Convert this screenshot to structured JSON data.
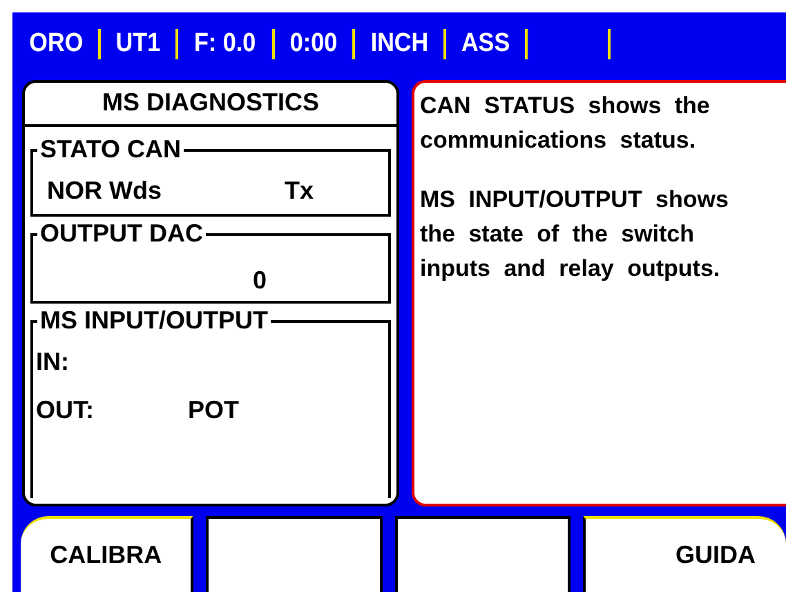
{
  "status_bar": [
    {
      "text": "ORO"
    },
    {
      "text": "UT1"
    },
    {
      "text": "F: 0.0"
    },
    {
      "text": "0:00"
    },
    {
      "text": "INCH"
    },
    {
      "text": "ASS"
    }
  ],
  "diagnostics": {
    "title": "MS DIAGNOSTICS",
    "groups": [
      {
        "title": "STATO CAN",
        "kind": "pair",
        "values": [
          "NOR Wds",
          "Tx"
        ]
      },
      {
        "title": "OUTPUT DAC",
        "kind": "value",
        "values": [
          "0"
        ]
      },
      {
        "title": "MS INPUT/OUTPUT",
        "kind": "io",
        "rows": [
          {
            "label": "IN:"
          },
          {
            "label": "OUT:",
            "value": "POT"
          }
        ]
      }
    ]
  },
  "help": {
    "paragraphs": [
      "CAN STATUS shows the communications status.",
      "MS INPUT/OUTPUT shows the state of the switch inputs and relay outputs."
    ]
  },
  "softkeys": [
    {
      "kind": "label",
      "label": "CALIBRA"
    },
    {
      "kind": "blank"
    },
    {
      "kind": "blank"
    },
    {
      "kind": "label",
      "label": "GUIDA"
    }
  ]
}
